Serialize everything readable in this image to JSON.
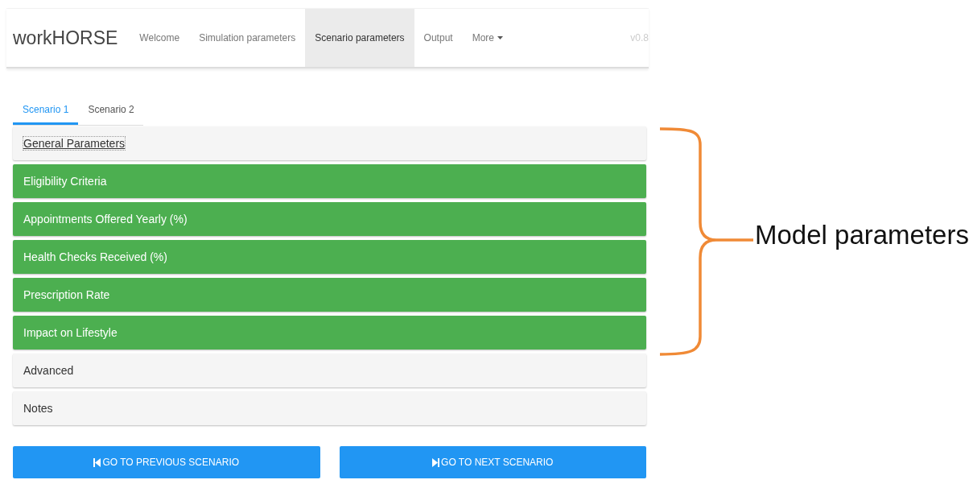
{
  "navbar": {
    "brand": "workHORSE",
    "items": [
      {
        "label": "Welcome",
        "selected": false,
        "dropdown": false
      },
      {
        "label": "Simulation parameters",
        "selected": false,
        "dropdown": false
      },
      {
        "label": "Scenario parameters",
        "selected": true,
        "dropdown": false
      },
      {
        "label": "Output",
        "selected": false,
        "dropdown": false
      },
      {
        "label": "More",
        "selected": false,
        "dropdown": true
      }
    ],
    "version": "v0.8"
  },
  "tabs": [
    {
      "label": "Scenario 1",
      "selected": true
    },
    {
      "label": "Scenario 2",
      "selected": false
    }
  ],
  "panels": [
    {
      "title": "General Parameters",
      "highlighted": false,
      "focused": true
    },
    {
      "title": "Eligibility Criteria",
      "highlighted": true,
      "focused": false
    },
    {
      "title": "Appointments Offered Yearly (%)",
      "highlighted": true,
      "focused": false
    },
    {
      "title": "Health Checks Received (%)",
      "highlighted": true,
      "focused": false
    },
    {
      "title": "Prescription Rate",
      "highlighted": true,
      "focused": false
    },
    {
      "title": "Impact on Lifestyle",
      "highlighted": true,
      "focused": false
    },
    {
      "title": "Advanced",
      "highlighted": false,
      "focused": false
    },
    {
      "title": "Notes",
      "highlighted": false,
      "focused": false
    }
  ],
  "buttons": [
    {
      "label": "GO TO PREVIOUS SCENARIO",
      "kind": "previous"
    },
    {
      "label": "GO TO NEXT SCENARIO",
      "kind": "next"
    }
  ],
  "annotation": {
    "label": "Model parameters"
  }
}
